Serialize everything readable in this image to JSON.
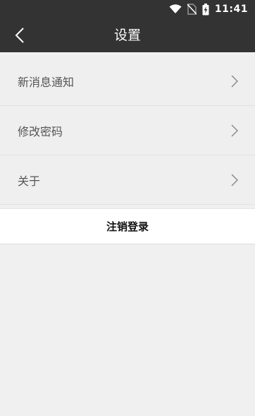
{
  "status_bar": {
    "time": "11:41",
    "icons": [
      "wifi-icon",
      "no-sim-icon",
      "battery-charging-icon"
    ]
  },
  "header": {
    "title": "设置",
    "back_icon": "chevron-left-icon"
  },
  "settings": {
    "items": [
      {
        "label": "新消息通知",
        "icon": "chevron-right-icon"
      },
      {
        "label": "修改密码",
        "icon": "chevron-right-icon"
      },
      {
        "label": "关于",
        "icon": "chevron-right-icon"
      }
    ]
  },
  "logout": {
    "label": "注销登录"
  },
  "colors": {
    "header_bg": "#333333",
    "page_bg": "#f0f0f0",
    "item_bg": "#efefef",
    "logout_bg": "#ffffff"
  }
}
